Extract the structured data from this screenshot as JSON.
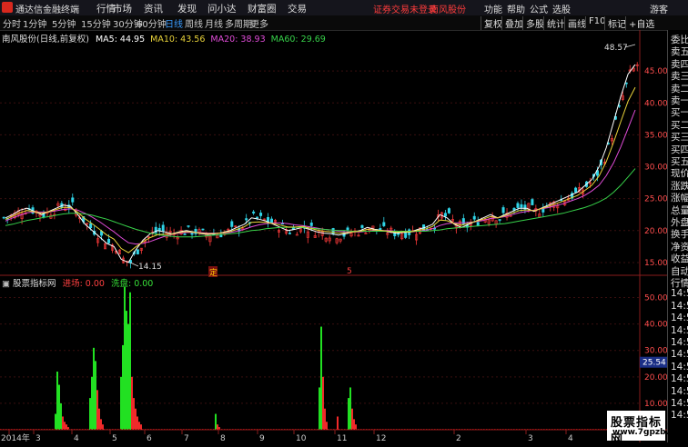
{
  "topbar": {
    "app_title": "通达信金融终端",
    "menu": [
      "行情",
      "市场",
      "资讯",
      "发现",
      "问小达",
      "财富圈",
      "交易"
    ],
    "alert": "证券交易未登录",
    "stock_name": "南风股份",
    "right_menu": [
      "功能",
      "帮助",
      "公式",
      "选股"
    ],
    "guest": "游客"
  },
  "toolbar": {
    "timeframes": [
      "分时",
      "1分钟",
      "5分钟",
      "15分钟",
      "30分钟",
      "60分钟",
      "日线",
      "周线",
      "月线",
      "多周期",
      "更多"
    ],
    "active": "日线",
    "buttons": [
      "复权",
      "叠加",
      "多股",
      "统计",
      "画线",
      "F10",
      "标记",
      "+自选"
    ]
  },
  "legend": {
    "title": "南风股份(日线,前复权)",
    "ma5": "MA5: 44.95",
    "ma10": "MA10: 43.56",
    "ma20": "MA20: 38.93",
    "ma60": "MA60: 29.69"
  },
  "indicator_legend": {
    "name": "股票指标网",
    "in_label": "进场: 0.00",
    "out_label": "洗盘: 0.00"
  },
  "right_panel": [
    "委比",
    "卖五",
    "卖四",
    "卖三",
    "卖二",
    "卖一",
    "买一",
    "买二",
    "买三",
    "买四",
    "买五",
    "现价",
    "涨跌",
    "涨幅",
    "总量",
    "外盘",
    "换手",
    "净资",
    "收益",
    "自动",
    "行情",
    "14:50",
    "14:50",
    "14:50",
    "14:50",
    "14:50",
    "14:50",
    "14:50",
    "14:50",
    "14:50",
    "14:50",
    "14:50"
  ],
  "annotations": {
    "high": "48.57",
    "low": "14.15",
    "marker1": "定",
    "marker2": "5"
  },
  "current_indicator_value": "25.54",
  "watermark": {
    "main": "股票指标网",
    "url": "www.7gpzb.com"
  },
  "chart_data": [
    {
      "type": "line",
      "ylim": [
        13,
        50
      ],
      "y_ticks": [
        15,
        20,
        25,
        30,
        35,
        40,
        45
      ],
      "x_tick_labels": [
        "2014年",
        "3",
        "4",
        "5",
        "6",
        "7",
        "8",
        "9",
        "10",
        "11",
        "12",
        "2",
        "3",
        "4"
      ],
      "series": [
        {
          "values": [
            22,
            22.5,
            23.2,
            23.5,
            23,
            22.5,
            23,
            23.5,
            24,
            23.8,
            22.5,
            21,
            20,
            19,
            18,
            17.5,
            15.5,
            15,
            17,
            18.5,
            19.5,
            20,
            19.8,
            19.5,
            19.8,
            20,
            19.8,
            19.5,
            19.4,
            19.5,
            19.7,
            20,
            20.5,
            21,
            22,
            21.8,
            21.5,
            21,
            20.5,
            20,
            20.2,
            20.5,
            20.2,
            19.8,
            19.6,
            19.5,
            19.3,
            19.5,
            19.8,
            20,
            20.5,
            20.2,
            20,
            19.8,
            19.6,
            19.7,
            19.8,
            20.2,
            20.5,
            21,
            22.5,
            22,
            21,
            20.5,
            21,
            21.5,
            22,
            22.5,
            22,
            22.5,
            23,
            23.5,
            23.5,
            23,
            23.5,
            24,
            24.5,
            25,
            25.5,
            26,
            27,
            28,
            30,
            33,
            37,
            41,
            44.5,
            46
          ]
        },
        {
          "values": [
            21.5,
            22,
            22.4,
            22.8,
            22.9,
            22.9,
            22.9,
            23.1,
            23.3,
            23.4,
            23.2,
            22.7,
            22.1,
            21.4,
            20.6,
            19.8,
            18.9,
            18.1,
            17.9,
            18,
            18.3,
            18.7,
            19.1,
            19.4,
            19.6,
            19.7,
            19.7,
            19.7,
            19.6,
            19.6,
            19.6,
            19.7,
            19.9,
            20.2,
            20.6,
            20.9,
            21.1,
            21.2,
            21.2,
            21.1,
            20.9,
            20.8,
            20.6,
            20.4,
            20.2,
            20.1,
            19.9,
            19.8,
            19.8,
            19.8,
            19.9,
            20,
            20,
            20,
            19.9,
            19.9,
            19.8,
            19.9,
            20,
            20.3,
            20.8,
            21.1,
            21.2,
            21.2,
            21.3,
            21.4,
            21.6,
            21.9,
            22,
            22.2,
            22.5,
            22.8,
            23,
            23.2,
            23.4,
            23.6,
            23.9,
            24.2,
            24.6,
            25,
            25.5,
            26.2,
            27.1,
            28.6,
            30.6,
            33.1,
            36,
            38.9
          ]
        },
        {
          "values": [
            20.8,
            21,
            21.3,
            21.6,
            21.8,
            22,
            22.2,
            22.4,
            22.6,
            22.7,
            22.7,
            22.6,
            22.4,
            22.1,
            21.8,
            21.4,
            21,
            20.6,
            20.2,
            19.9,
            19.6,
            19.4,
            19.2,
            19.1,
            19,
            19,
            19,
            19.1,
            19.2,
            19.3,
            19.4,
            19.5,
            19.6,
            19.8,
            20,
            20.1,
            20.3,
            20.4,
            20.5,
            20.5,
            20.5,
            20.5,
            20.4,
            20.3,
            20.2,
            20.1,
            20,
            20,
            19.9,
            19.9,
            19.9,
            19.9,
            19.9,
            19.9,
            19.9,
            19.9,
            19.9,
            19.9,
            19.9,
            20,
            20.1,
            20.3,
            20.4,
            20.5,
            20.6,
            20.7,
            20.8,
            20.9,
            21,
            21.1,
            21.3,
            21.5,
            21.7,
            21.9,
            22.1,
            22.3,
            22.5,
            22.7,
            23,
            23.3,
            23.6,
            24,
            24.5,
            25.1,
            26,
            27.1,
            28.4,
            29.7
          ]
        }
      ]
    },
    {
      "type": "bar",
      "ylim": [
        0,
        55
      ],
      "y_ticks": [
        10,
        20,
        30,
        40,
        50
      ],
      "bars": [
        {
          "x": 60,
          "v": 6,
          "c": "g"
        },
        {
          "x": 62,
          "v": 22,
          "c": "g"
        },
        {
          "x": 64,
          "v": 17,
          "c": "g"
        },
        {
          "x": 66,
          "v": 10,
          "c": "g"
        },
        {
          "x": 68,
          "v": 5,
          "c": "r"
        },
        {
          "x": 70,
          "v": 3,
          "c": "r"
        },
        {
          "x": 72,
          "v": 2,
          "c": "r"
        },
        {
          "x": 74,
          "v": 1,
          "c": "r"
        },
        {
          "x": 98,
          "v": 12,
          "c": "g"
        },
        {
          "x": 100,
          "v": 20,
          "c": "g"
        },
        {
          "x": 102,
          "v": 31,
          "c": "g"
        },
        {
          "x": 104,
          "v": 26,
          "c": "g"
        },
        {
          "x": 106,
          "v": 15,
          "c": "r"
        },
        {
          "x": 108,
          "v": 8,
          "c": "r"
        },
        {
          "x": 110,
          "v": 4,
          "c": "r"
        },
        {
          "x": 112,
          "v": 2,
          "c": "r"
        },
        {
          "x": 132,
          "v": 20,
          "c": "g"
        },
        {
          "x": 134,
          "v": 32,
          "c": "g"
        },
        {
          "x": 136,
          "v": 54,
          "c": "g"
        },
        {
          "x": 138,
          "v": 45,
          "c": "g"
        },
        {
          "x": 140,
          "v": 40,
          "c": "g"
        },
        {
          "x": 142,
          "v": 52,
          "c": "g"
        },
        {
          "x": 144,
          "v": 20,
          "c": "r"
        },
        {
          "x": 146,
          "v": 12,
          "c": "r"
        },
        {
          "x": 148,
          "v": 8,
          "c": "r"
        },
        {
          "x": 150,
          "v": 5,
          "c": "r"
        },
        {
          "x": 152,
          "v": 3,
          "c": "r"
        },
        {
          "x": 154,
          "v": 2,
          "c": "r"
        },
        {
          "x": 236,
          "v": 6,
          "c": "g"
        },
        {
          "x": 238,
          "v": 2,
          "c": "r"
        },
        {
          "x": 240,
          "v": 1,
          "c": "r"
        },
        {
          "x": 350,
          "v": 16,
          "c": "g"
        },
        {
          "x": 352,
          "v": 39,
          "c": "g"
        },
        {
          "x": 354,
          "v": 20,
          "c": "r"
        },
        {
          "x": 356,
          "v": 8,
          "c": "r"
        },
        {
          "x": 358,
          "v": 3,
          "c": "r"
        },
        {
          "x": 370,
          "v": 5,
          "c": "r"
        },
        {
          "x": 382,
          "v": 12,
          "c": "g"
        },
        {
          "x": 384,
          "v": 16,
          "c": "g"
        },
        {
          "x": 386,
          "v": 8,
          "c": "r"
        },
        {
          "x": 388,
          "v": 4,
          "c": "r"
        },
        {
          "x": 390,
          "v": 2,
          "c": "r"
        }
      ]
    }
  ]
}
